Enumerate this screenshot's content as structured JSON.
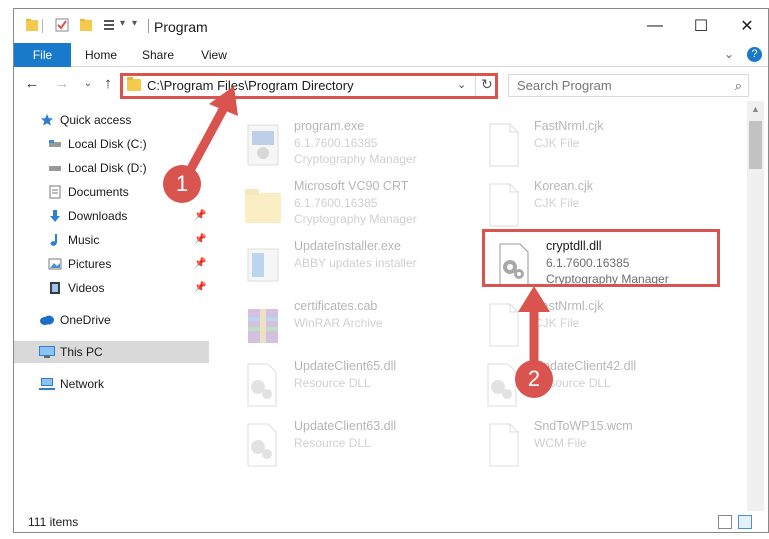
{
  "window": {
    "title": "Program",
    "controls": {
      "minimize": "—",
      "maximize": "☐",
      "close": "✕"
    }
  },
  "ribbon": {
    "tabs": [
      "File",
      "Home",
      "Share",
      "View"
    ],
    "collapse": "⌄",
    "help": "?"
  },
  "nav": {
    "back": "←",
    "forward": "→",
    "recent": "⌄",
    "up": "↑"
  },
  "address": {
    "path": "C:\\Program Files\\Program Directory",
    "dropdown": "⌄",
    "refresh": "↻"
  },
  "search": {
    "placeholder": "Search Program",
    "icon": "⌕"
  },
  "sidebar": {
    "items": [
      {
        "label": "Quick access",
        "icon": "star-icon"
      },
      {
        "label": "Local Disk (C:)",
        "icon": "drive-icon"
      },
      {
        "label": "Local Disk (D:)",
        "icon": "drive-icon"
      },
      {
        "label": "Documents",
        "icon": "documents-icon"
      },
      {
        "label": "Downloads",
        "icon": "download-icon",
        "pinned": true
      },
      {
        "label": "Music",
        "icon": "music-icon",
        "pinned": true
      },
      {
        "label": "Pictures",
        "icon": "pictures-icon",
        "pinned": true
      },
      {
        "label": "Videos",
        "icon": "videos-icon",
        "pinned": true
      },
      {
        "label": "OneDrive",
        "icon": "cloud-icon"
      },
      {
        "label": "This PC",
        "icon": "computer-icon",
        "selected": true
      },
      {
        "label": "Network",
        "icon": "network-icon"
      }
    ],
    "pin_glyph": "📌"
  },
  "files": [
    {
      "name": "program.exe",
      "version": "6.1.7600.16385",
      "description": "Cryptography Manager",
      "icon": "exe-icon"
    },
    {
      "name": "FastNrml.cjk",
      "version": "",
      "description": "CJK File",
      "icon": "blank-file-icon"
    },
    {
      "name": "Microsoft VC90 CRT",
      "version": "6.1.7600.16385",
      "description": "Cryptography Manager",
      "icon": "folder-icon"
    },
    {
      "name": "Korean.cjk",
      "version": "",
      "description": "CJK File",
      "icon": "blank-file-icon"
    },
    {
      "name": "UpdateInstaller.exe",
      "version": "",
      "description": "ABBY updates installer",
      "icon": "installer-icon"
    },
    {
      "name": "cryptdll.dll",
      "version": "6.1.7600.16385",
      "description": "Cryptography Manager",
      "icon": "dll-gear-icon"
    },
    {
      "name": "certificates.cab",
      "version": "",
      "description": "WinRAR Archive",
      "icon": "archive-icon"
    },
    {
      "name": "FastNrml.cjk",
      "version": "",
      "description": "CJK File",
      "icon": "blank-file-icon"
    },
    {
      "name": "UpdateClient65.dll",
      "version": "",
      "description": "Resource DLL",
      "icon": "dll-gear-icon"
    },
    {
      "name": "UpdateClient42.dll",
      "version": "",
      "description": "Resource DLL",
      "icon": "dll-gear-icon"
    },
    {
      "name": "UpdateClient63.dll",
      "version": "",
      "description": "Resource DLL",
      "icon": "dll-gear-icon"
    },
    {
      "name": "SndToWP15.wcm",
      "version": "",
      "description": "WCM File",
      "icon": "blank-file-icon"
    }
  ],
  "status": {
    "item_count": "111 items"
  },
  "callouts": [
    "1",
    "2"
  ],
  "colors": {
    "accent": "#1979ca",
    "annotation": "#d9534f",
    "selected": "#d9d9d9"
  }
}
